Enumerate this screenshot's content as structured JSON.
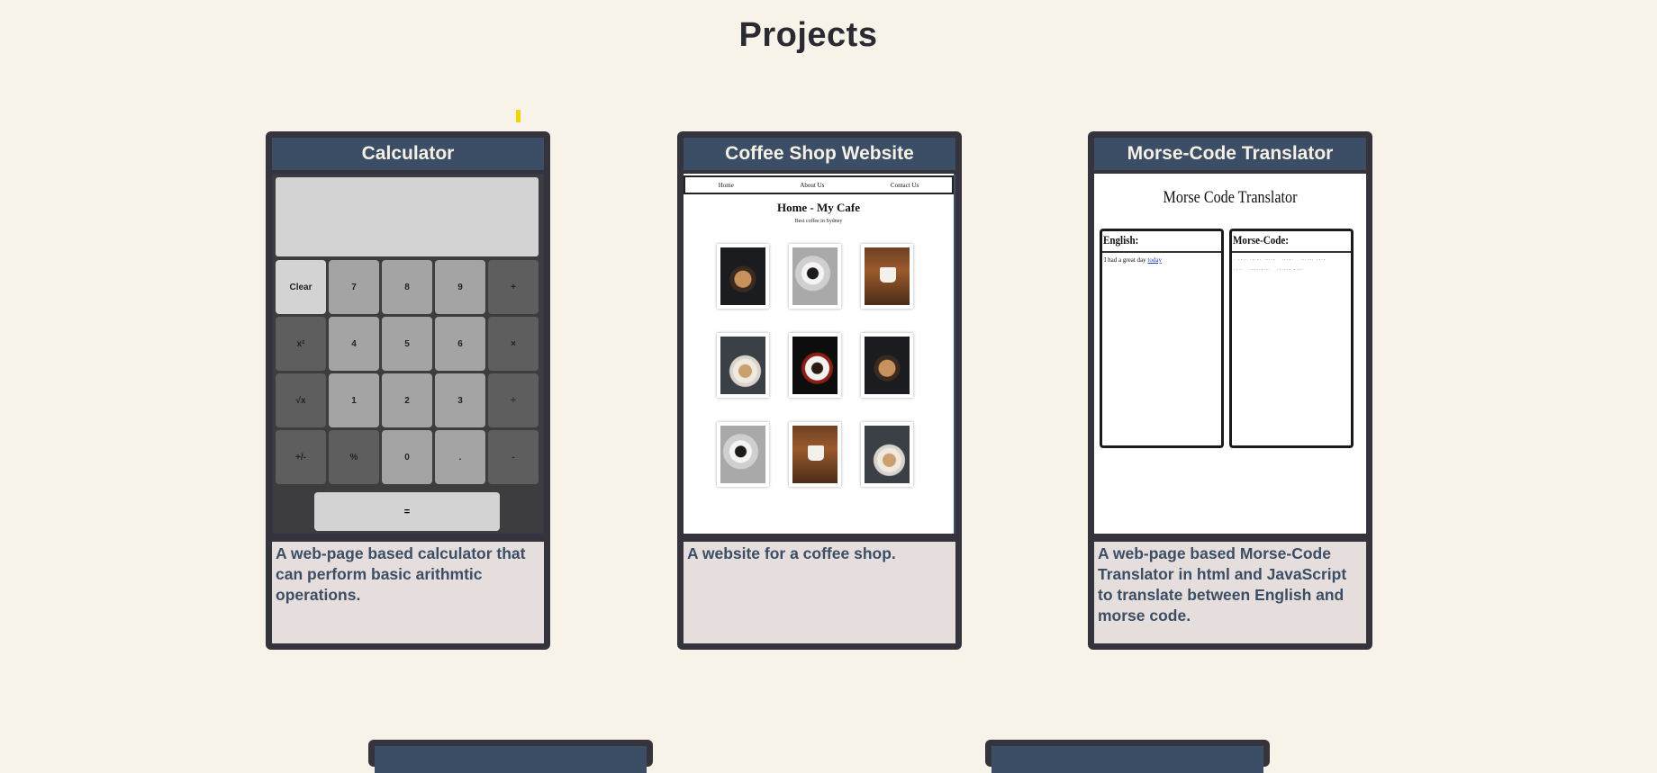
{
  "page": {
    "title": "Projects"
  },
  "projects": [
    {
      "title": "Calculator",
      "description": "A web-page based calculator that can perform basic arithmtic operations.",
      "preview": {
        "keys": [
          [
            "Clear",
            "7",
            "8",
            "9",
            "+"
          ],
          [
            "x²",
            "4",
            "5",
            "6",
            "×"
          ],
          [
            "√x",
            "1",
            "2",
            "3",
            "÷"
          ],
          [
            "+/-",
            "%",
            "0",
            ".",
            "-"
          ]
        ],
        "equals": "="
      }
    },
    {
      "title": "Coffee Shop Website",
      "description": "A website for a coffee shop.",
      "preview": {
        "nav": [
          "Home",
          "About Us",
          "Contact Us"
        ],
        "heading": "Home - My Cafe",
        "subheading": "Best coffee in Sydney"
      }
    },
    {
      "title": "Morse-Code Translator",
      "description": "A web-page based Morse-Code Translator in html and JavaScript to translate between English and morse code.",
      "preview": {
        "heading": "Morse Code Translator",
        "english_label": "English:",
        "morse_label": "Morse-Code:",
        "english_text": "I had a great day",
        "english_link": "today"
      }
    }
  ],
  "colors": {
    "background": "#f8f3e9",
    "card": "#35343d",
    "header": "#3b4e65",
    "description_bg": "#e6dedc"
  }
}
